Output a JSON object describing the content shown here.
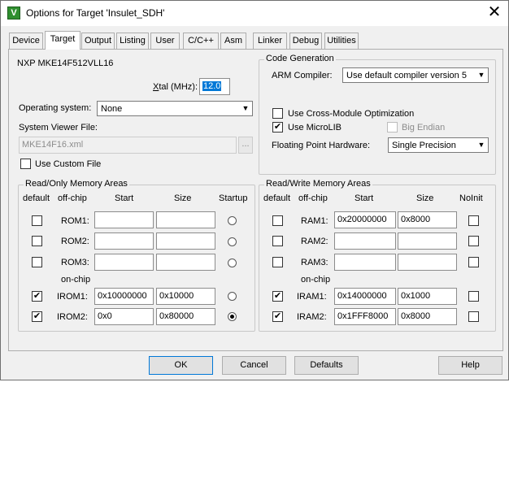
{
  "window": {
    "title": "Options for Target 'Insulet_SDH'",
    "icon_letter": "V",
    "close_glyph": "✕"
  },
  "tabs": [
    {
      "label": "Device",
      "active": false
    },
    {
      "label": "Target",
      "active": true
    },
    {
      "label": "Output",
      "active": false
    },
    {
      "label": "Listing",
      "active": false
    },
    {
      "label": "User",
      "active": false
    },
    {
      "label": "C/C++",
      "active": false
    },
    {
      "label": "Asm",
      "active": false
    },
    {
      "label": "Linker",
      "active": false
    },
    {
      "label": "Debug",
      "active": false
    },
    {
      "label": "Utilities",
      "active": false
    }
  ],
  "target": {
    "device_name": "NXP MKE14F512VLL16",
    "xtal_label_prefix": "X",
    "xtal_label_rest": "tal (MHz):",
    "xtal_value": "12.0",
    "os_label": "Operating system:",
    "os_value": "None",
    "svf_label": "System Viewer File:",
    "svf_value": "MKE14F16.xml",
    "browse_label": "...",
    "custom_file_label": "Use Custom File",
    "custom_file_checked": false
  },
  "code_generation": {
    "title": "Code Generation",
    "arm_compiler_label": "ARM Compiler:",
    "arm_compiler_value": "Use default compiler version 5",
    "cross_module_label": "Use Cross-Module Optimization",
    "cross_module_checked": false,
    "microlib_label": "Use MicroLIB",
    "microlib_checked": true,
    "big_endian_label": "Big Endian",
    "big_endian_checked": false,
    "fp_label": "Floating Point Hardware:",
    "fp_value": "Single Precision"
  },
  "rom_areas": {
    "title": "Read/Only Memory Areas",
    "headers": {
      "default": "default",
      "offchip": "off-chip",
      "start": "Start",
      "size": "Size",
      "extra": "Startup"
    },
    "onchip_label": "on-chip",
    "rows": [
      {
        "name": "ROM1:",
        "default": false,
        "start": "",
        "size": "",
        "startup": false
      },
      {
        "name": "ROM2:",
        "default": false,
        "start": "",
        "size": "",
        "startup": false
      },
      {
        "name": "ROM3:",
        "default": false,
        "start": "",
        "size": "",
        "startup": false
      },
      {
        "name": "IROM1:",
        "default": true,
        "start": "0x10000000",
        "size": "0x10000",
        "startup": false
      },
      {
        "name": "IROM2:",
        "default": true,
        "start": "0x0",
        "size": "0x80000",
        "startup": true
      }
    ]
  },
  "ram_areas": {
    "title": "Read/Write Memory Areas",
    "headers": {
      "default": "default",
      "offchip": "off-chip",
      "start": "Start",
      "size": "Size",
      "extra": "NoInit"
    },
    "onchip_label": "on-chip",
    "rows": [
      {
        "name": "RAM1:",
        "default": false,
        "start": "0x20000000",
        "size": "0x8000",
        "noinit": false
      },
      {
        "name": "RAM2:",
        "default": false,
        "start": "",
        "size": "",
        "noinit": false
      },
      {
        "name": "RAM3:",
        "default": false,
        "start": "",
        "size": "",
        "noinit": false
      },
      {
        "name": "IRAM1:",
        "default": true,
        "start": "0x14000000",
        "size": "0x1000",
        "noinit": false
      },
      {
        "name": "IRAM2:",
        "default": true,
        "start": "0x1FFF8000",
        "size": "0x8000",
        "noinit": false
      }
    ]
  },
  "buttons": {
    "ok": "OK",
    "cancel": "Cancel",
    "defaults": "Defaults",
    "help": "Help"
  },
  "glyphs": {
    "check": "✔",
    "dropdown_arrow": "▼"
  }
}
